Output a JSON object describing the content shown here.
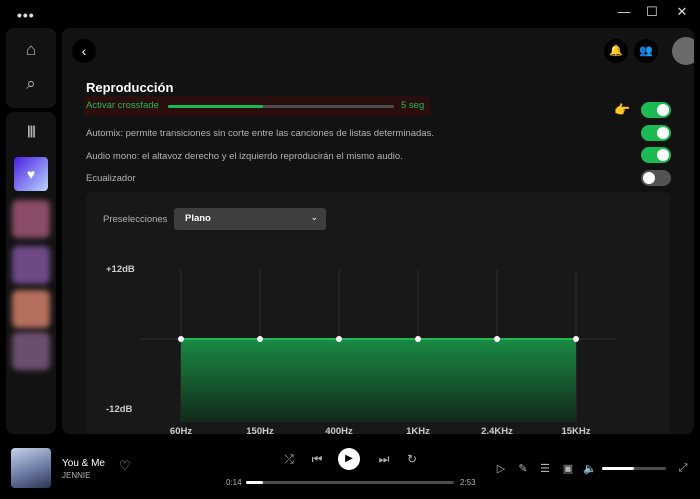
{
  "window": {
    "menu_dots": "•••",
    "minimize": "—",
    "maximize": "☐",
    "close": "✕"
  },
  "sidebar": {
    "home_icon": "⌂",
    "search_icon": "⌕",
    "library_icon": "|||",
    "liked_icon": "♥",
    "playlist_colors": [
      "#8a4c68",
      "#6d4a86",
      "#b56f5d",
      "#6b4f6e"
    ]
  },
  "header": {
    "back_icon": "‹",
    "notifications_icon": "🔔",
    "friends_icon": "👥"
  },
  "settings": {
    "section_title": "Reproducción",
    "crossfade": {
      "label": "Activar crossfade",
      "value_text": "5 seg",
      "fraction": 0.42,
      "enabled": true
    },
    "automix": {
      "label": "Automix: permite transiciones sin corte entre las canciones de listas determinadas.",
      "enabled": true
    },
    "mono": {
      "label": "Audio mono: el altavoz derecho y el izquierdo reproducirán el mismo audio.",
      "enabled": true
    },
    "equalizer": {
      "label": "Ecualizador",
      "enabled": false
    },
    "pointer_icon": "👉"
  },
  "equalizer": {
    "preset_label": "Preselecciones",
    "preset_value": "Plano",
    "preset_chevron": "⌄",
    "db_max_label": "+12dB",
    "db_min_label": "-12dB",
    "accent_color": "#1db954"
  },
  "chart_data": {
    "type": "area",
    "categories": [
      "60Hz",
      "150Hz",
      "400Hz",
      "1KHz",
      "2.4KHz",
      "15KHz"
    ],
    "values": [
      0,
      0,
      0,
      0,
      0,
      0
    ],
    "ylim": [
      -12,
      12
    ],
    "grid": true
  },
  "player": {
    "track_title": "You & Me",
    "artist": "JENNIE",
    "heart_icon": "♡",
    "shuffle_icon": "⤮",
    "prev_icon": "⏮",
    "play_icon": "▶",
    "next_icon": "⏭",
    "repeat_icon": "↻",
    "elapsed": "0:14",
    "duration": "2:53",
    "progress_fraction": 0.08,
    "now_playing_icon": "▷",
    "lyrics_icon": "✎",
    "queue_icon": "☰",
    "devices_icon": "▣",
    "volume_icon": "🔈",
    "volume_fraction": 0.5,
    "fullscreen_icon": "⤢"
  }
}
